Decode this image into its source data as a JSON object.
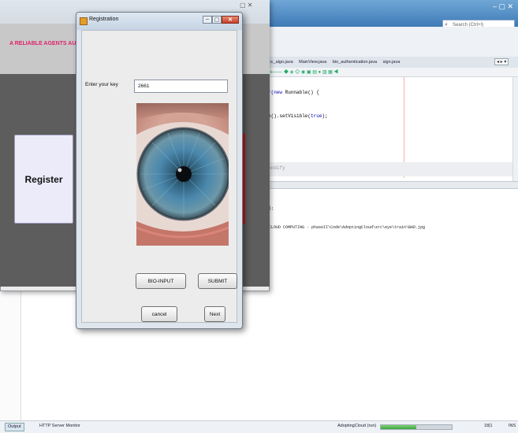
{
  "ide": {
    "search_placeholder": "Search (Ctrl+I)",
    "window_controls": "–  ▢  ✕",
    "tabs": [
      "ecc_algo.java",
      "MainView.java",
      "bio_authentication.java",
      "sign.java"
    ],
    "tab_overflow": "◂ ▸ ▾",
    "editor_toolbar": "🡐 ◆ ◈ ◇ ◉ ▣ ▤ ● ▥ ▦ ◀",
    "code_line_1_kw": "r(new",
    "code_line_1_rest": " Runnable() {",
    "code_line_2_pre": "n().setVisible(",
    "code_line_2_kw": "true",
    "code_line_2_post": ");",
    "code_line_3": "modify",
    "output_line_1": ");",
    "output_line_2": "CLOUD COMPUTING - phaseII\\Code\\AdoptingCloud\\src\\eye\\train\\BAD.jpg",
    "status": {
      "output_tab": "Output",
      "http_monitor": "HTTP Server Monitor",
      "project": "AdoptingCloud (run)",
      "progress_fraction": 0.5,
      "position": "18|1",
      "mode": "INS"
    }
  },
  "app": {
    "tagline": "A RELIABLE AGENTS AUTHE",
    "window_controls": "▢  ✕",
    "register_label": "Register"
  },
  "dialog": {
    "title": "Registration",
    "min_label": "–",
    "max_label": "▢",
    "close_label": "✕",
    "key_label": "Enter your key",
    "key_value": "2661",
    "bio_input_label": "BIO-INPUT",
    "submit_label": "SUBMIT",
    "cancel_label": "cancel",
    "next_label": "Next"
  },
  "colors": {
    "tagline": "#e0226b",
    "app_dark_panel": "#5d5d5d",
    "register_card": "#ecebfa",
    "iris": "#3d7fa8"
  },
  "icons": [
    "search-icon",
    "dialog-app-icon",
    "eye-image"
  ]
}
